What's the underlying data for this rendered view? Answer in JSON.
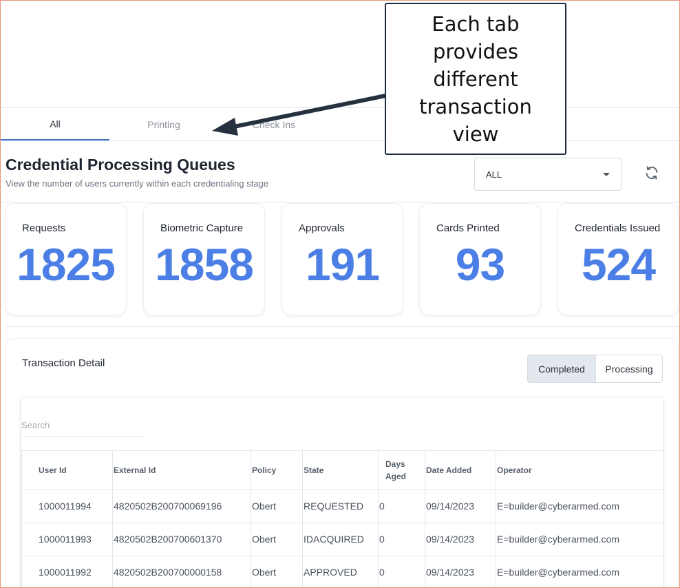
{
  "tabs": [
    {
      "label": "All",
      "active": true
    },
    {
      "label": "Printing",
      "active": false
    },
    {
      "label": "Check Ins",
      "active": false
    }
  ],
  "queues": {
    "title": "Credential Processing Queues",
    "subtitle": "View the number of users currently within each credentialing stage",
    "filter": {
      "selected": "ALL"
    },
    "refresh_icon": "refresh-icon"
  },
  "cards": [
    {
      "label": "Requests",
      "value": "1825"
    },
    {
      "label": "Biometric Capture",
      "value": "1858"
    },
    {
      "label": "Approvals",
      "value": "191"
    },
    {
      "label": "Cards Printed",
      "value": "93"
    },
    {
      "label": "Credentials Issued",
      "value": "524"
    }
  ],
  "detail": {
    "title": "Transaction Detail",
    "toggle": {
      "completed": "Completed",
      "processing": "Processing"
    },
    "search_placeholder": "Search",
    "columns": [
      "User Id",
      "External Id",
      "Policy",
      "State",
      "Days Aged",
      "Date Added",
      "Operator"
    ],
    "rows": [
      [
        "1000011994",
        "4820502B200700069196",
        "Obert",
        "REQUESTED",
        "0",
        "09/14/2023",
        "E=builder@cyberarmed.com"
      ],
      [
        "1000011993",
        "4820502B200700601370",
        "Obert",
        "IDACQUIRED",
        "0",
        "09/14/2023",
        "E=builder@cyberarmed.com"
      ],
      [
        "1000011992",
        "4820502B200700000158",
        "Obert",
        "APPROVED",
        "0",
        "09/14/2023",
        "E=builder@cyberarmed.com"
      ]
    ]
  },
  "annotation": {
    "text_lines": [
      "Each tab",
      "provides",
      "different",
      "transaction",
      "view"
    ]
  },
  "colors": {
    "accent": "#4b7fe6",
    "tab_underline": "#3d6fc4",
    "callout_border": "#1f2a38"
  }
}
